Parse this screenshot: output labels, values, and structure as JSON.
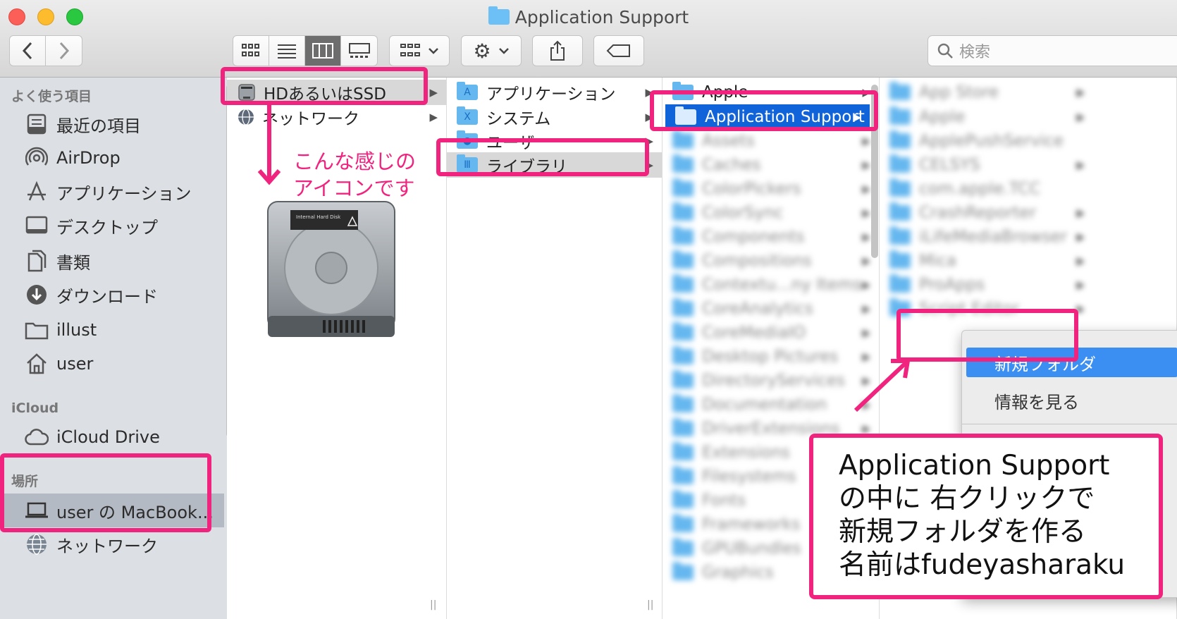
{
  "window": {
    "title": "Application Support",
    "search_placeholder": "検索"
  },
  "sidebar": {
    "favorites_header": "よく使う項目",
    "favorites": [
      {
        "label": "最近の項目",
        "icon": "recents-icon"
      },
      {
        "label": "AirDrop",
        "icon": "airdrop-icon"
      },
      {
        "label": "アプリケーション",
        "icon": "applications-icon"
      },
      {
        "label": "デスクトップ",
        "icon": "desktop-icon"
      },
      {
        "label": "書類",
        "icon": "documents-icon"
      },
      {
        "label": "ダウンロード",
        "icon": "downloads-icon"
      },
      {
        "label": "illust",
        "icon": "folder-icon"
      },
      {
        "label": "user",
        "icon": "home-icon"
      }
    ],
    "icloud_header": "iCloud",
    "icloud": [
      {
        "label": "iCloud Drive",
        "icon": "icloud-icon"
      }
    ],
    "locations_header": "場所",
    "locations": [
      {
        "label": "user の MacBook...",
        "icon": "laptop-icon",
        "selected": true
      },
      {
        "label": "ネットワーク",
        "icon": "network-icon"
      }
    ]
  },
  "column1": {
    "items": [
      {
        "label": "HDあるいはSSD",
        "selected": true
      },
      {
        "label": "ネットワーク"
      }
    ]
  },
  "column2": {
    "items": [
      {
        "label": "アプリケーション"
      },
      {
        "label": "システム"
      },
      {
        "label": "ユーザ"
      },
      {
        "label": "ライブラリ",
        "selected": true
      }
    ]
  },
  "column3": {
    "items": [
      {
        "label": "Apple"
      },
      {
        "label": "Application Support",
        "selected": true
      },
      {
        "label": "Assets"
      },
      {
        "label": "Caches"
      },
      {
        "label": "ColorPickers"
      },
      {
        "label": "ColorSync"
      },
      {
        "label": "Components"
      },
      {
        "label": "Compositions"
      },
      {
        "label": "Contextu...ny Items"
      },
      {
        "label": "CoreAnalytics"
      },
      {
        "label": "CoreMediaIO"
      },
      {
        "label": "Desktop Pictures"
      },
      {
        "label": "DirectoryServices"
      },
      {
        "label": "Documentation"
      },
      {
        "label": "DriverExtensions"
      },
      {
        "label": "Extensions"
      },
      {
        "label": "Filesystems"
      },
      {
        "label": "Fonts"
      },
      {
        "label": "Frameworks"
      },
      {
        "label": "GPUBundles"
      },
      {
        "label": "Graphics"
      }
    ]
  },
  "column4": {
    "items": [
      {
        "label": "App Store"
      },
      {
        "label": "Apple"
      },
      {
        "label": "ApplePushService"
      },
      {
        "label": "CELSYS"
      },
      {
        "label": "com.apple.TCC"
      },
      {
        "label": "CrashReporter"
      },
      {
        "label": "iLifeMediaBrowser"
      },
      {
        "label": "Mica"
      },
      {
        "label": "ProApps"
      },
      {
        "label": "Script Editor"
      }
    ]
  },
  "context_menu": {
    "new_folder": "新規フォルダ",
    "get_info": "情報を見る"
  },
  "annotations": {
    "icon_note_line1": "こんな感じの",
    "icon_note_line2": "アイコンです",
    "disk_label": "Internal Hard Disk",
    "callout_lines": [
      "Application Support",
      "の中に 右クリックで",
      "新規フォルダを作る",
      "名前はfudeyasharaku"
    ],
    "highlight_color": "#f0247e"
  }
}
